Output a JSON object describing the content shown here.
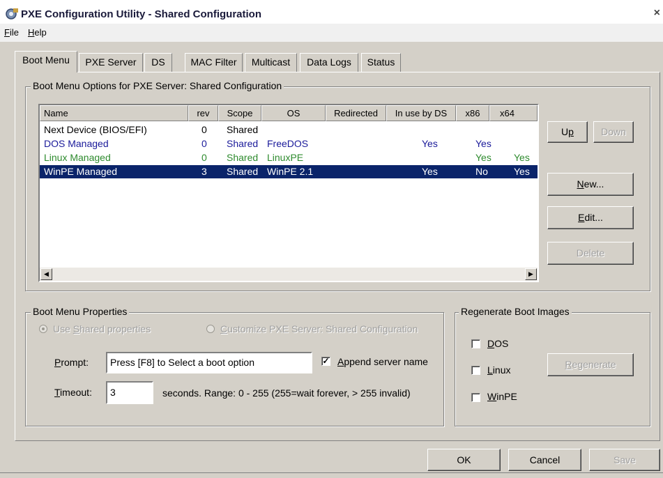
{
  "window": {
    "title": "PXE Configuration Utility - Shared Configuration",
    "close_glyph": "×"
  },
  "menu": [
    {
      "mnemonic": "F",
      "rest": "ile"
    },
    {
      "mnemonic": "H",
      "rest": "elp"
    }
  ],
  "tabs": [
    "Boot Menu",
    "PXE Server",
    "DS",
    "MAC Filter",
    "Multicast",
    "Data Logs",
    "Status"
  ],
  "boot_menu_options": {
    "group_label": "Boot Menu Options for PXE Server:  Shared Configuration",
    "columns": [
      "Name",
      "rev",
      "Scope",
      "OS",
      "Redirected",
      "In use by DS",
      "x86",
      "x64"
    ],
    "rows": [
      {
        "name": "Next Device (BIOS/EFI)",
        "rev": "0",
        "scope": "Shared",
        "os": "",
        "redirected": "",
        "in_use": "",
        "x86": "",
        "x64": "",
        "color": "#000000"
      },
      {
        "name": "DOS Managed",
        "rev": "0",
        "scope": "Shared",
        "os": "FreeDOS",
        "redirected": "",
        "in_use": "Yes",
        "x86": "Yes",
        "x64": "",
        "color": "#1a1a9a"
      },
      {
        "name": "Linux Managed",
        "rev": "0",
        "scope": "Shared",
        "os": "LinuxPE",
        "redirected": "",
        "in_use": "",
        "x86": "Yes",
        "x64": "Yes",
        "color": "#2e8b2e"
      },
      {
        "name": "WinPE Managed",
        "rev": "3",
        "scope": "Shared",
        "os": "WinPE 2.1",
        "redirected": "",
        "in_use": "Yes",
        "x86": "No",
        "x64": "Yes",
        "color": "#ffffff",
        "selected": true
      }
    ],
    "buttons": {
      "up": {
        "mnemonic": "p",
        "pre": "U",
        "post": ""
      },
      "down": "Down",
      "new": {
        "mnemonic": "N",
        "rest": "ew..."
      },
      "edit": {
        "mnemonic": "E",
        "rest": "dit..."
      },
      "delete": "Delete"
    }
  },
  "boot_menu_properties": {
    "group_label": "Boot Menu Properties",
    "radio_shared": {
      "pre": "Use ",
      "mnemonic": "S",
      "rest": "hared properties"
    },
    "radio_custom": {
      "mnemonic": "C",
      "rest": "ustomize PXE Server:  Shared Configuration"
    },
    "prompt_label": {
      "mnemonic": "P",
      "rest": "rompt:"
    },
    "prompt_value": "Press [F8] to Select a boot option",
    "append_checked": true,
    "append_label": {
      "mnemonic": "A",
      "rest": "ppend server name"
    },
    "timeout_label": {
      "mnemonic": "T",
      "rest": "imeout:"
    },
    "timeout_value": "3",
    "timeout_hint": "seconds.  Range: 0 - 255 (255=wait forever, > 255 invalid)"
  },
  "regenerate": {
    "group_label": "Regenerate Boot Images",
    "dos": {
      "mnemonic": "D",
      "rest": "OS"
    },
    "linux": {
      "mnemonic": "L",
      "rest": "inux"
    },
    "winpe": {
      "mnemonic": "W",
      "rest": "inPE"
    },
    "button": {
      "mnemonic": "R",
      "rest": "egenerate"
    }
  },
  "footer": {
    "ok": "OK",
    "cancel": "Cancel",
    "save": "Save"
  }
}
